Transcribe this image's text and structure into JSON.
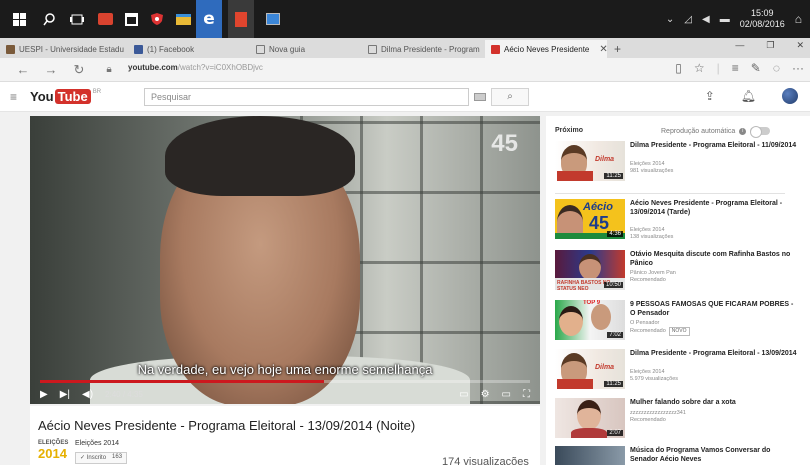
{
  "taskbar": {
    "icons": [
      "windows-start-icon",
      "search-icon",
      "task-view-icon",
      "mail-icon",
      "store-icon",
      "shield-icon",
      "file-explorer-icon",
      "edge-icon",
      "pdf-icon",
      "app-icon"
    ],
    "clock_time": "15:09",
    "clock_date": "02/08/2016"
  },
  "tabs": [
    {
      "label": "UESPI - Universidade Estadu",
      "active": false
    },
    {
      "label": "(1) Facebook",
      "active": false
    },
    {
      "label": "Nova guia",
      "active": false
    },
    {
      "label": "Dilma Presidente - Program",
      "active": false
    },
    {
      "label": "Aécio Neves Presidente",
      "active": true
    }
  ],
  "addressbar": {
    "domain": "youtube.com",
    "path": "/watch?v=iC0XhOBDjvc"
  },
  "ytheader": {
    "logo_you": "You",
    "logo_tube": "Tube",
    "logo_country": "BR",
    "search_placeholder": "Pesquisar"
  },
  "player": {
    "channel_bug": "45",
    "subtitle": "Na verdade, eu vejo hoje uma enorme semelhança",
    "time": "2:40 / 4:35",
    "progress_fraction": 0.58
  },
  "video": {
    "title": "Aécio Neves Presidente - Programa Eleitoral - 13/09/2014 (Noite)",
    "channel_logo_top": "ELEIÇÕES",
    "channel_logo_year": "2014",
    "channel_name": "Eleições 2014",
    "subscribe_label": "✓ Inscrito",
    "subscriber_count": "163",
    "views": "174 visualizações"
  },
  "sidebar": {
    "next_label": "Próximo",
    "autoplay_label": "Reprodução automática",
    "items": [
      {
        "title": "Dilma Presidente - Programa Eleitoral - 11/09/2014",
        "channel": "Eleições 2014",
        "views": "981 visualizações",
        "duration": "11:25"
      },
      {
        "title": "Aécio Neves Presidente - Programa Eleitoral - 13/09/2014 (Tarde)",
        "channel": "Eleições 2014",
        "views": "138 visualizações",
        "duration": "4:36"
      },
      {
        "title": "Otávio Mesquita discute com Rafinha Bastos no Pânico",
        "channel": "Pânico Jovem Pan",
        "views": "Recomendado",
        "duration": "10:50"
      },
      {
        "title": "9 PESSOAS FAMOSAS QUE FICARAM POBRES - O Pensador",
        "channel": "O Pensador",
        "views": "Recomendado",
        "badge": "NOVO",
        "duration": "7:02"
      },
      {
        "title": "Dilma Presidente - Programa Eleitoral - 13/09/2014",
        "channel": "Eleições 2014",
        "views": "5.979 visualizações",
        "duration": "11:25"
      },
      {
        "title": "Mulher falando sobre dar a xota",
        "channel": "zzzzzzzzzzzzzzzzz341",
        "views": "Recomendado",
        "duration": "2:07"
      },
      {
        "title": "Música do Programa Vamos Conversar do Senador Aécio Neves",
        "channel": "",
        "views": "",
        "duration": ""
      }
    ]
  },
  "colors": {
    "youtube_red": "#d3312b",
    "progress_red": "#cc181e",
    "taskbar": "#1b1b1b"
  }
}
